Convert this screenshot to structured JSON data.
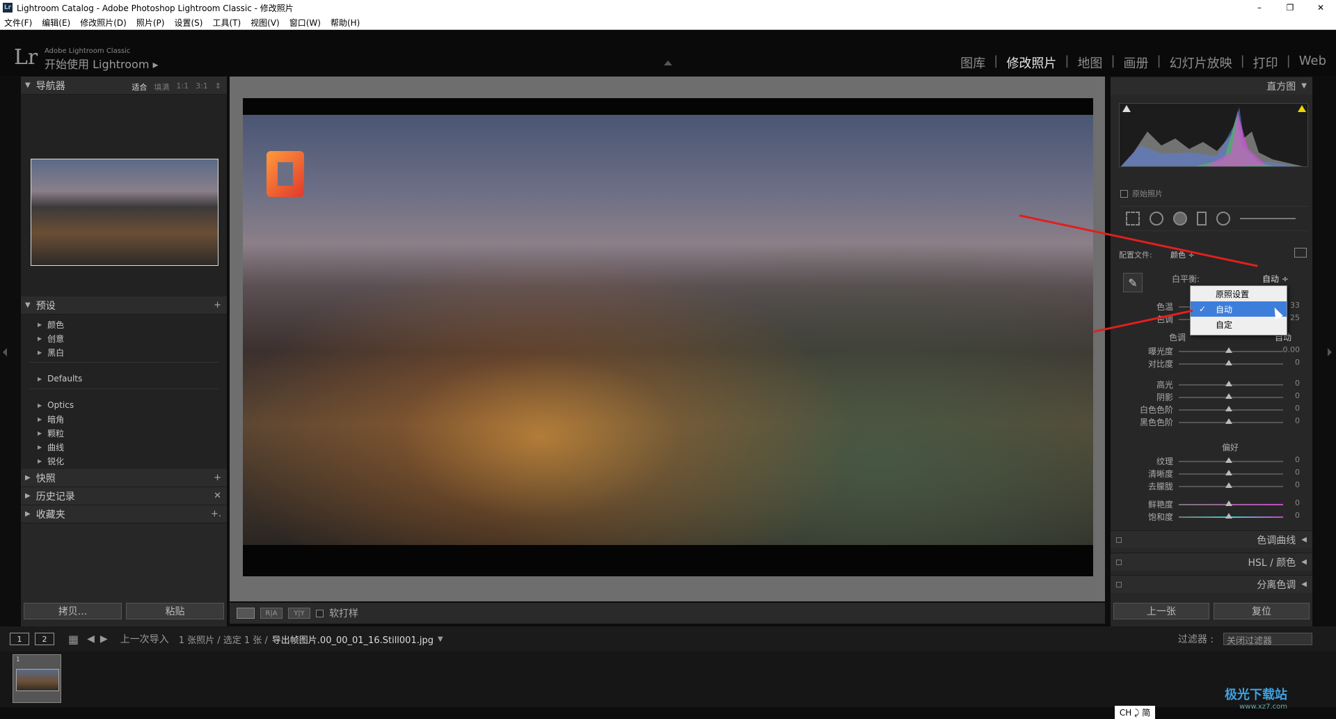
{
  "window": {
    "title": "Lightroom Catalog - Adobe Photoshop Lightroom Classic - 修改照片",
    "app_icon": "Lr",
    "controls": {
      "minimize": "–",
      "restore": "❐",
      "close": "✕"
    }
  },
  "menu": [
    "文件(F)",
    "编辑(E)",
    "修改照片(D)",
    "照片(P)",
    "设置(S)",
    "工具(T)",
    "视图(V)",
    "窗口(W)",
    "帮助(H)"
  ],
  "brand": {
    "logo": "Lr",
    "small": "Adobe Lightroom Classic",
    "big": "开始使用 Lightroom ▸"
  },
  "modules": [
    "图库",
    "修改照片",
    "地图",
    "画册",
    "幻灯片放映",
    "打印",
    "Web"
  ],
  "module_sep": "|",
  "left": {
    "navigator": {
      "title": "导航器",
      "zoom": [
        "适合",
        "填满",
        "1:1",
        "3:1",
        "⇕"
      ]
    },
    "presets": {
      "title": "预设",
      "add": "+",
      "groups": [
        [
          "颜色",
          "创意",
          "黑白"
        ],
        [
          "Defaults"
        ],
        [
          "Optics",
          "暗角",
          "颗粒",
          "曲线",
          "锐化"
        ]
      ]
    },
    "snapshots": {
      "title": "快照",
      "action": "+"
    },
    "history": {
      "title": "历史记录",
      "action": "✕"
    },
    "collections": {
      "title": "收藏夹",
      "action": "+."
    },
    "buttons": {
      "copy": "拷贝...",
      "paste": "粘贴"
    }
  },
  "center_toolbar": {
    "view1": "R|A",
    "view2": "Y|Y",
    "soft_proof": "软打样"
  },
  "right": {
    "histogram": {
      "title": "直方图"
    },
    "original_photo": "原始照片",
    "profile": {
      "label": "配置文件:",
      "value": "颜色 ÷"
    },
    "white_balance": {
      "label": "白平衡:",
      "value": "自动 ÷"
    },
    "wb_sliders": [
      {
        "label": "色温",
        "value": "+ 33"
      },
      {
        "label": "色调",
        "value": "+ 25"
      }
    ],
    "tone": {
      "title": "色调",
      "auto": "自动"
    },
    "tone_sliders": [
      {
        "label": "曝光度",
        "value": "0.00"
      },
      {
        "label": "对比度",
        "value": "0"
      },
      {
        "label": "高光",
        "value": "0"
      },
      {
        "label": "阴影",
        "value": "0"
      },
      {
        "label": "白色色阶",
        "value": "0"
      },
      {
        "label": "黑色色阶",
        "value": "0"
      }
    ],
    "presence": {
      "title": "偏好"
    },
    "presence_sliders": [
      {
        "label": "纹理",
        "value": "0"
      },
      {
        "label": "清晰度",
        "value": "0"
      },
      {
        "label": "去朦胧",
        "value": "0"
      },
      {
        "label": "鲜艳度",
        "value": "0"
      },
      {
        "label": "饱和度",
        "value": "0"
      }
    ],
    "sections": [
      "色调曲线",
      "HSL / 颜色",
      "分离色调"
    ],
    "buttons": {
      "previous": "上一张",
      "reset": "复位"
    }
  },
  "wb_dropdown": {
    "items": [
      "原照设置",
      "自动",
      "自定"
    ],
    "selected": 1,
    "check": "✓"
  },
  "filmbar": {
    "views": [
      "1",
      "2"
    ],
    "source": "上一次导入",
    "count": "1 张照片 / 选定 1 张 /",
    "filename": "导出帧图片.00_00_01_16.Still001.jpg",
    "filter_label": "过滤器 :",
    "filter_value": "关闭过滤器"
  },
  "filmstrip": {
    "index": "1"
  },
  "ime": "CH ⤸ 简",
  "watermark": {
    "main": "极光下载站",
    "sub": "www.xz7.com"
  },
  "colors": {
    "arrow": "#e0201e",
    "selection": "#3d7edb",
    "panel": "#272727"
  }
}
